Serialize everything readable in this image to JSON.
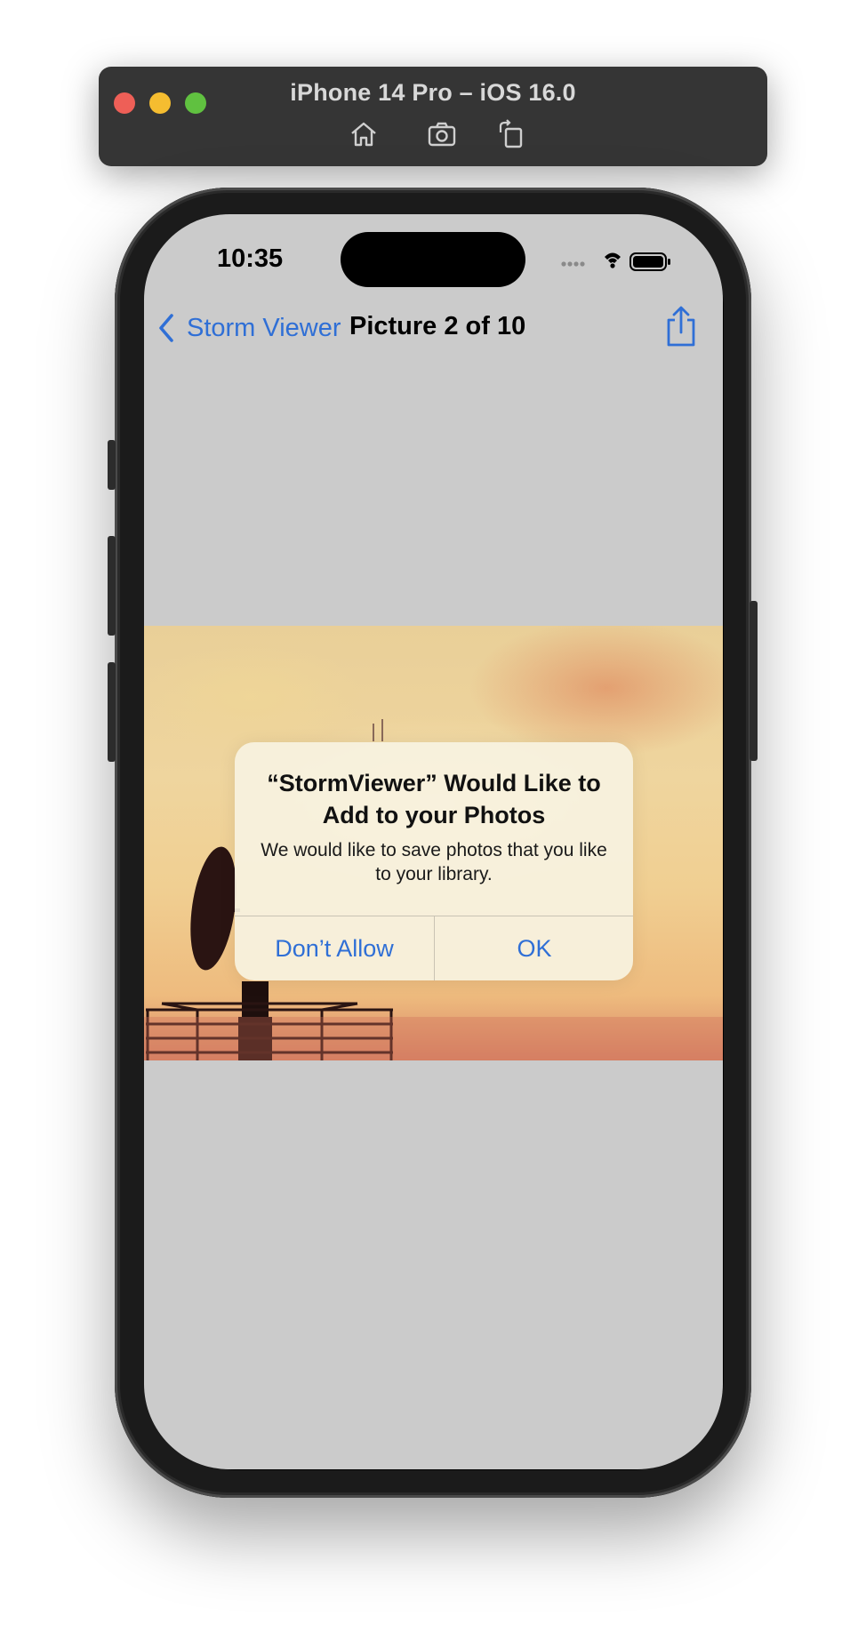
{
  "simulator": {
    "title": "iPhone 14 Pro – iOS 16.0",
    "tools": [
      "home-icon",
      "screenshot-icon",
      "rotate-icon"
    ]
  },
  "status_bar": {
    "time": "10:35",
    "icons": [
      "cellular-dots-icon",
      "wifi-icon",
      "battery-icon"
    ]
  },
  "nav": {
    "back_label": "Storm Viewer",
    "title": "Picture 2 of 10",
    "action_icon": "share-icon"
  },
  "alert": {
    "title": "“StormViewer” Would Like to Add to your Photos",
    "message": "We would like to save photos that you like to your library.",
    "buttons": {
      "deny": "Don’t Allow",
      "allow": "OK"
    }
  },
  "colors": {
    "accent": "#2f6fd6",
    "screen_background": "#cbcbcb"
  }
}
